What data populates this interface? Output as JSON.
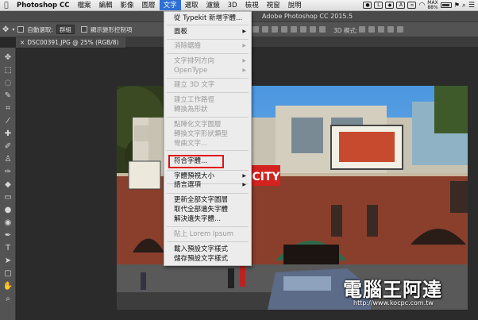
{
  "menubar": {
    "items": [
      "Photoshop CC",
      "檔案",
      "編輯",
      "影像",
      "圖層",
      "文字",
      "選取",
      "濾鏡",
      "3D",
      "檢視",
      "視窗",
      "說明"
    ],
    "active_index": 5,
    "battery_pct": "88%",
    "status_icons": [
      "wechat-icon",
      "line-icon",
      "dropbox-icon",
      "acrobat-icon",
      "cc-icon",
      "wifi-icon",
      "battery-icon",
      "flag-icon",
      "search-icon",
      "list-icon"
    ]
  },
  "window": {
    "title": "Adobe Photoshop CC 2015.5"
  },
  "options_bar": {
    "auto_select_label": "自動選取:",
    "auto_select_value": "群組",
    "show_transform_label": "顯示變形控制項",
    "mode_3d_label": "3D 模式:"
  },
  "document": {
    "tab_title": "DSC00391.JPG @ 25% (RGB/8)"
  },
  "text_menu": {
    "items": [
      {
        "label": "從 Typekit 新增字體...",
        "disabled": false,
        "submenu": false
      },
      {
        "label": "面板",
        "disabled": false,
        "submenu": true
      },
      {
        "label": "消除鋸齒",
        "disabled": true,
        "submenu": true
      },
      {
        "label": "文字排列方向",
        "disabled": true,
        "submenu": true
      },
      {
        "label": "OpenType",
        "disabled": true,
        "submenu": true
      },
      {
        "label": "建立 3D 文字",
        "disabled": true,
        "submenu": false
      },
      {
        "label": "建立工作路徑",
        "disabled": true,
        "submenu": false
      },
      {
        "label": "轉換為形狀",
        "disabled": true,
        "submenu": false
      },
      {
        "label": "點陣化文字圖層",
        "disabled": true,
        "submenu": false
      },
      {
        "label": "轉換文字形狀類型",
        "disabled": true,
        "submenu": false
      },
      {
        "label": "彎曲文字...",
        "disabled": true,
        "submenu": false
      },
      {
        "label": "符合字體...",
        "disabled": false,
        "submenu": false
      },
      {
        "label": "字體預視大小",
        "disabled": false,
        "submenu": true
      },
      {
        "label": "語言選項",
        "disabled": false,
        "submenu": true
      },
      {
        "label": "更新全部文字圖層",
        "disabled": false,
        "submenu": false
      },
      {
        "label": "取代全部遺失字體",
        "disabled": false,
        "submenu": false
      },
      {
        "label": "解決遺失字體...",
        "disabled": false,
        "submenu": false
      },
      {
        "label": "貼上 Lorem Ipsum",
        "disabled": true,
        "submenu": false
      },
      {
        "label": "載入預設文字樣式",
        "disabled": false,
        "submenu": false
      },
      {
        "label": "儲存預設文字樣式",
        "disabled": false,
        "submenu": false
      }
    ],
    "highlighted": "符合字體..."
  },
  "photo_sign": "CITY",
  "watermark": {
    "title": "電腦王阿達",
    "url": "http://www.kocpc.com.tw"
  },
  "colors": {
    "menu_highlight": "#2e6fd6",
    "callout_border": "#e01212",
    "panel_bg": "#535353"
  }
}
